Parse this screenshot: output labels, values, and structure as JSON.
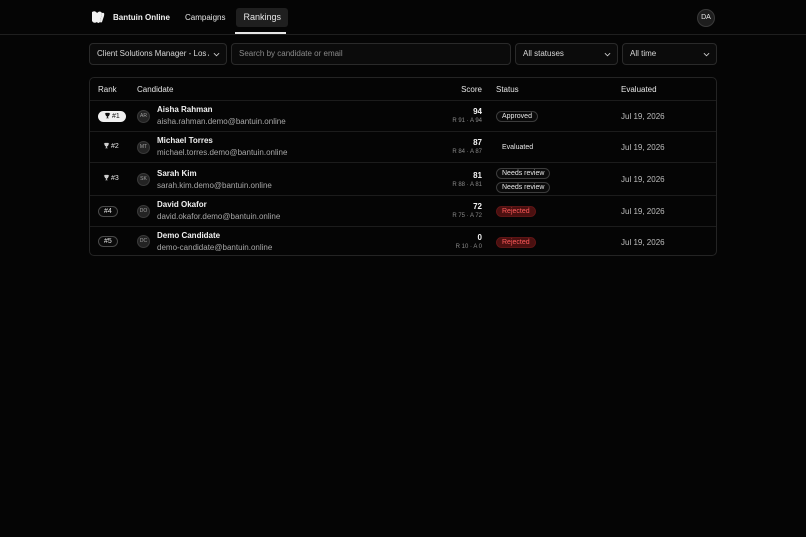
{
  "header": {
    "brand": "Bantuin Online",
    "nav": [
      {
        "label": "Campaigns",
        "active": false
      },
      {
        "label": "Rankings",
        "active": true
      }
    ],
    "user_initials": "DA"
  },
  "filters": {
    "campaign": "Client Solutions Manager - Los A",
    "search_placeholder": "Search by candidate or email",
    "status": "All statuses",
    "time": "All time"
  },
  "table": {
    "columns": {
      "rank": "Rank",
      "candidate": "Candidate",
      "score": "Score",
      "status": "Status",
      "evaluated": "Evaluated"
    },
    "rows": [
      {
        "rank": "#1",
        "trophy": true,
        "initials": "AR",
        "name": "Aisha Rahman",
        "email": "aisha.rahman.demo@bantuin.online",
        "score": "94",
        "sub": "R 91 · A 94",
        "statuses": [
          {
            "label": "Approved",
            "kind": "approved"
          }
        ],
        "evaluated": "Jul 19, 2026"
      },
      {
        "rank": "#2",
        "trophy": true,
        "initials": "MT",
        "name": "Michael Torres",
        "email": "michael.torres.demo@bantuin.online",
        "score": "87",
        "sub": "R 84 · A 87",
        "statuses": [
          {
            "label": "Evaluated",
            "kind": "evaluated"
          }
        ],
        "evaluated": "Jul 19, 2026"
      },
      {
        "rank": "#3",
        "trophy": true,
        "initials": "SK",
        "name": "Sarah Kim",
        "email": "sarah.kim.demo@bantuin.online",
        "score": "81",
        "sub": "R 88 · A 81",
        "statuses": [
          {
            "label": "Needs review",
            "kind": "review"
          },
          {
            "label": "Needs review",
            "kind": "review"
          }
        ],
        "evaluated": "Jul 19, 2026"
      },
      {
        "rank": "#4",
        "trophy": false,
        "initials": "DO",
        "name": "David Okafor",
        "email": "david.okafor.demo@bantuin.online",
        "score": "72",
        "sub": "R 75 · A 72",
        "statuses": [
          {
            "label": "Rejected",
            "kind": "rejected"
          }
        ],
        "evaluated": "Jul 19, 2026"
      },
      {
        "rank": "#5",
        "trophy": false,
        "initials": "DC",
        "name": "Demo Candidate",
        "email": "demo-candidate@bantuin.online",
        "score": "0",
        "sub": "R 10 · A 0",
        "statuses": [
          {
            "label": "Rejected",
            "kind": "rejected"
          }
        ],
        "evaluated": "Jul 19, 2026"
      }
    ]
  },
  "colors": {
    "background": "#050505",
    "rejected_text": "#ff5a5a",
    "rejected_bg": "#4a1010"
  }
}
